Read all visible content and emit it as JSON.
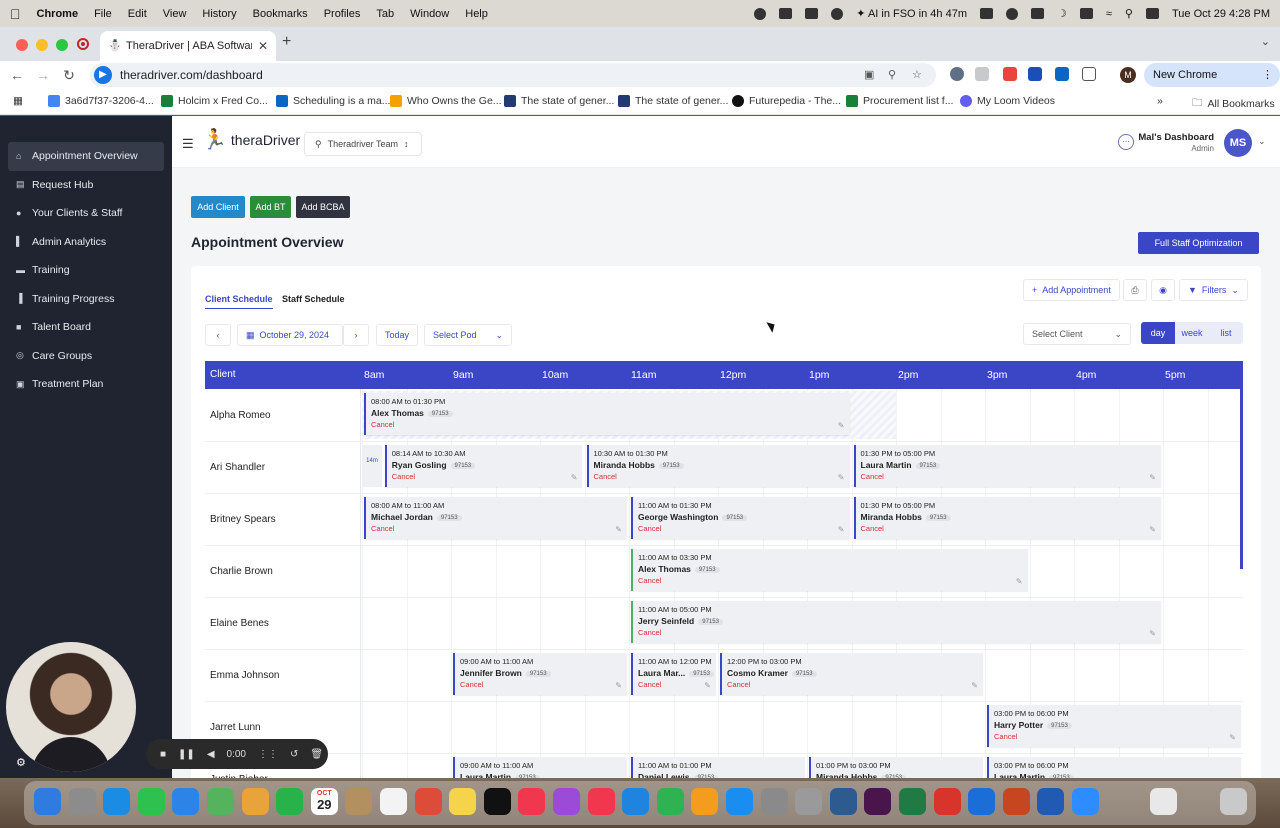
{
  "menubar": {
    "app": "Chrome",
    "items": [
      "File",
      "Edit",
      "View",
      "History",
      "Bookmarks",
      "Profiles",
      "Tab",
      "Window",
      "Help"
    ],
    "status_text": "AI in FSO in 4h 47m",
    "datetime": "Tue Oct 29  4:28 PM"
  },
  "browser": {
    "tab_title": "TheraDriver | ABA Software",
    "url": "theradriver.com/dashboard",
    "new_chrome_label": "New Chrome available",
    "profile_initial": "M",
    "bookmarks": [
      {
        "label": "3a6d7f37-3206-4...",
        "color": "#4285f4"
      },
      {
        "label": "Holcim x Fred Co...",
        "color": "#188038"
      },
      {
        "label": "Scheduling is a ma...",
        "color": "#0a66c2"
      },
      {
        "label": "Who Owns the Ge...",
        "color": "#f4a100"
      },
      {
        "label": "The state of gener...",
        "color": "#243a73"
      },
      {
        "label": "The state of gener...",
        "color": "#243a73"
      },
      {
        "label": "Futurepedia - The...",
        "color": "#111111"
      },
      {
        "label": "Procurement list f...",
        "color": "#188038"
      },
      {
        "label": "My Loom Videos",
        "color": "#625df5"
      }
    ],
    "all_bookmarks": "All Bookmarks"
  },
  "sidebar": {
    "items": [
      {
        "label": "Appointment Overview",
        "icon": "home-icon",
        "active": true
      },
      {
        "label": "Request Hub",
        "icon": "clipboard-icon"
      },
      {
        "label": "Your Clients & Staff",
        "icon": "users-icon"
      },
      {
        "label": "Admin Analytics",
        "icon": "chart-icon"
      },
      {
        "label": "Training",
        "icon": "dumbbell-icon"
      },
      {
        "label": "Training Progress",
        "icon": "progress-icon"
      },
      {
        "label": "Talent Board",
        "icon": "board-icon"
      },
      {
        "label": "Care Groups",
        "icon": "groups-icon"
      },
      {
        "label": "Treatment Plan",
        "icon": "plan-icon"
      }
    ]
  },
  "header": {
    "brand": "theraDriver",
    "team": "Theradriver Team",
    "dashboard_name": "Mal's Dashboard",
    "role": "Admin",
    "avatar_initials": "MS"
  },
  "actions": {
    "add_client": "Add Client",
    "add_bt": "Add BT",
    "add_bcba": "Add BCBA",
    "full_staff_optimization": "Full Staff Optimization"
  },
  "page_title": "Appointment Overview",
  "schedule": {
    "tabs": [
      "Client Schedule",
      "Staff Schedule"
    ],
    "add_appointment": "Add Appointment",
    "filters": "Filters",
    "date": "October 29, 2024",
    "today": "Today",
    "select_pod": "Select Pod",
    "select_client": "Select Client",
    "views": [
      "day",
      "week",
      "list"
    ],
    "active_view": "day",
    "column_client": "Client",
    "hours": [
      "8am",
      "9am",
      "10am",
      "11am",
      "12pm",
      "1pm",
      "2pm",
      "3pm",
      "4pm",
      "5pm"
    ],
    "cancel_label": "Cancel",
    "rows": [
      {
        "client": "Alpha Romeo",
        "appointments": [
          {
            "time": "08:00 AM to 01:30 PM",
            "staff": "Alex Thomas",
            "code": "97153",
            "start": 8.0,
            "end": 13.5
          }
        ]
      },
      {
        "client": "Ari Shandler",
        "minutes_badge": "14m",
        "appointments": [
          {
            "time": "08:14 AM to 10:30 AM",
            "staff": "Ryan Gosling",
            "code": "97153",
            "start": 8.233,
            "end": 10.5
          },
          {
            "time": "10:30 AM to 01:30 PM",
            "staff": "Miranda Hobbs",
            "code": "97153",
            "start": 10.5,
            "end": 13.5
          },
          {
            "time": "01:30 PM to 05:00 PM",
            "staff": "Laura Martin",
            "code": "97153",
            "start": 13.5,
            "end": 17.0
          }
        ]
      },
      {
        "client": "Britney Spears",
        "appointments": [
          {
            "time": "08:00 AM to 11:00 AM",
            "staff": "Michael Jordan",
            "code": "97153",
            "start": 8.0,
            "end": 11.0
          },
          {
            "time": "11:00 AM to 01:30 PM",
            "staff": "George Washington",
            "code": "97153",
            "start": 11.0,
            "end": 13.5
          },
          {
            "time": "01:30 PM to 05:00 PM",
            "staff": "Miranda Hobbs",
            "code": "97153",
            "start": 13.5,
            "end": 17.0
          }
        ]
      },
      {
        "client": "Charlie Brown",
        "appointments": [
          {
            "time": "11:00 AM to 03:30 PM",
            "staff": "Alex Thomas",
            "code": "97153",
            "start": 11.0,
            "end": 15.5,
            "style": "green"
          }
        ]
      },
      {
        "client": "Elaine Benes",
        "appointments": [
          {
            "time": "11:00 AM to 05:00 PM",
            "staff": "Jerry Seinfeld",
            "code": "97153",
            "start": 11.0,
            "end": 17.0,
            "style": "green"
          }
        ]
      },
      {
        "client": "Emma Johnson",
        "appointments": [
          {
            "time": "09:00 AM to 11:00 AM",
            "staff": "Jennifer Brown",
            "code": "97153",
            "start": 9.0,
            "end": 11.0
          },
          {
            "time": "11:00 AM to 12:00 PM",
            "staff": "Laura Mar...",
            "code": "97153",
            "start": 11.0,
            "end": 12.0
          },
          {
            "time": "12:00 PM to 03:00 PM",
            "staff": "Cosmo Kramer",
            "code": "97153",
            "start": 12.0,
            "end": 15.0
          }
        ]
      },
      {
        "client": "Jarret Lunn",
        "appointments": [
          {
            "time": "03:00 PM to 06:00 PM",
            "staff": "Harry Potter",
            "code": "97153",
            "start": 15.0,
            "end": 18.0
          }
        ]
      },
      {
        "client": "Justin Bieber",
        "appointments": [
          {
            "time": "09:00 AM to 11:00 AM",
            "staff": "Laura Martin",
            "code": "97153",
            "start": 9.0,
            "end": 11.0
          },
          {
            "time": "11:00 AM to 01:00 PM",
            "staff": "Daniel Lewis",
            "code": "97153",
            "start": 11.0,
            "end": 13.0
          },
          {
            "time": "01:00 PM to 03:00 PM",
            "staff": "Miranda Hobbs",
            "code": "97153",
            "start": 13.0,
            "end": 15.0
          },
          {
            "time": "03:00 PM to 06:00 PM",
            "staff": "Laura Martin",
            "code": "97153",
            "start": 15.0,
            "end": 18.0
          }
        ]
      }
    ]
  },
  "recorder": {
    "elapsed": "0:00"
  },
  "dock": {
    "calendar_month": "OCT",
    "calendar_day": "29"
  }
}
